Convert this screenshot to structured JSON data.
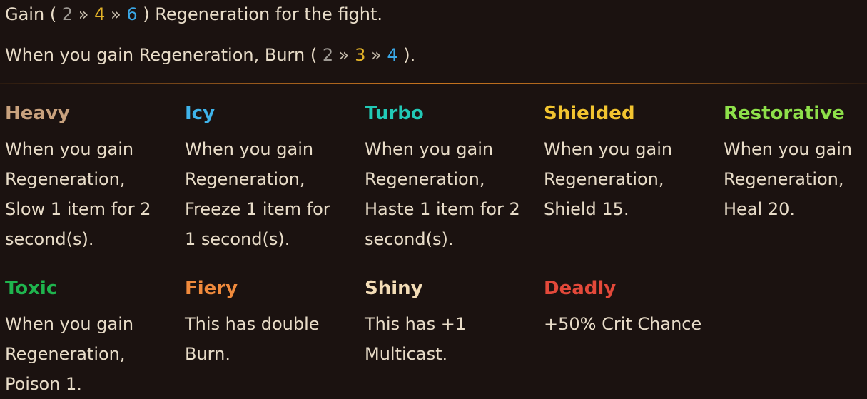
{
  "tooltip": {
    "line1": {
      "prefix": "Gain",
      "open": "(",
      "v1": "2",
      "sep1": "»",
      "v2": "4",
      "sep2": "»",
      "v3": "6",
      "close": ")",
      "suffix": "Regeneration for the fight."
    },
    "line2": {
      "prefix": "When you gain Regeneration, Burn",
      "open": "(",
      "v1": "2",
      "sep1": "»",
      "v2": "3",
      "sep2": "»",
      "v3": "4",
      "close": ")",
      "suffix": "."
    },
    "tier_colors": {
      "bronze": "#9f9a94",
      "gold": "#e2b228",
      "diamond": "#3aa7e6"
    }
  },
  "enchantments": [
    {
      "name": "Heavy",
      "color": "#c9a27e",
      "text": "When you gain\nRegeneration,\nSlow 1 item for 2\nsecond(s)."
    },
    {
      "name": "Icy",
      "color": "#3fb3ea",
      "text": "When you gain\nRegeneration,\nFreeze 1 item for\n1 second(s)."
    },
    {
      "name": "Turbo",
      "color": "#22c9b6",
      "text": "When you gain\nRegeneration,\nHaste 1 item for 2\nsecond(s)."
    },
    {
      "name": "Shielded",
      "color": "#f2c430",
      "text": "When you gain\nRegeneration,\nShield 15."
    },
    {
      "name": "Restorative",
      "color": "#8ee04a",
      "text": "When you gain\nRegeneration,\nHeal 20."
    },
    {
      "name": "Toxic",
      "color": "#1fb44e",
      "text": "When you gain\nRegeneration,\nPoison 1."
    },
    {
      "name": "Fiery",
      "color": "#f08a3c",
      "text": "This has double\nBurn."
    },
    {
      "name": "Shiny",
      "color": "#f3dcb6",
      "text": "This has +1\nMulticast."
    },
    {
      "name": "Deadly",
      "color": "#e3493a",
      "text": "+50% Crit Chance"
    }
  ]
}
